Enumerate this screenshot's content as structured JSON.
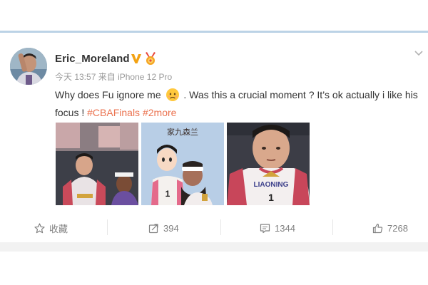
{
  "post": {
    "username": "Eric_Moreland",
    "verified_badge": "v-badge-icon",
    "medal_badge": "medal-icon",
    "timestamp": "今天 13:57",
    "source_prefix": "来自",
    "source_device": "iPhone 12 Pro",
    "text_part1": "Why does Fu ignore me",
    "emoji": "pouting-face-emoji",
    "text_part2": ". Was this a crucial moment ? It’s ok actually i like his focus !",
    "hashtag": "#CBAFinals",
    "more_link": "#2more",
    "images": [
      {
        "name": "post-image-1"
      },
      {
        "name": "post-image-2",
        "caption": "家九森兰",
        "jersey_number": "1"
      },
      {
        "name": "post-image-3",
        "jersey_text": "LIAONING",
        "jersey_number": "1"
      }
    ]
  },
  "toolbar": {
    "favorite_label": "收藏",
    "repost_count": "394",
    "comment_count": "1344",
    "like_count": "7268"
  },
  "colors": {
    "link": "#eb7350",
    "badge_orange": "#f3a213",
    "top_line": "#bcd3e6"
  }
}
